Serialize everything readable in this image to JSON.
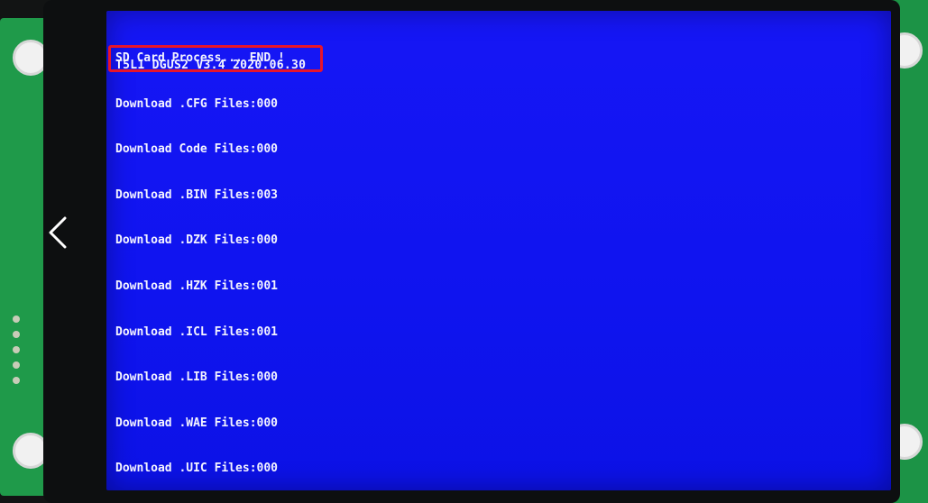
{
  "screen": {
    "header": "T5L1 DGUS2 V3.4 2020.06.30",
    "status": "SD Card Process... END !",
    "downloads": [
      "Download .CFG Files:000",
      "Download Code Files:000",
      "Download .BIN Files:003",
      "Download .DZK Files:000",
      "Download .HZK Files:001",
      "Download .ICL Files:001",
      "Download .LIB Files:000",
      "Download .WAE Files:000",
      "Download .UIC Files:000"
    ]
  },
  "navigation": {
    "back_icon": "chevron-left-icon"
  },
  "colors": {
    "screen_blue": "#1414f2",
    "text": "#f4f4ff",
    "highlight": "#e8152a",
    "pcb_green": "#1f9a4a",
    "bezel": "#0d0f10"
  }
}
